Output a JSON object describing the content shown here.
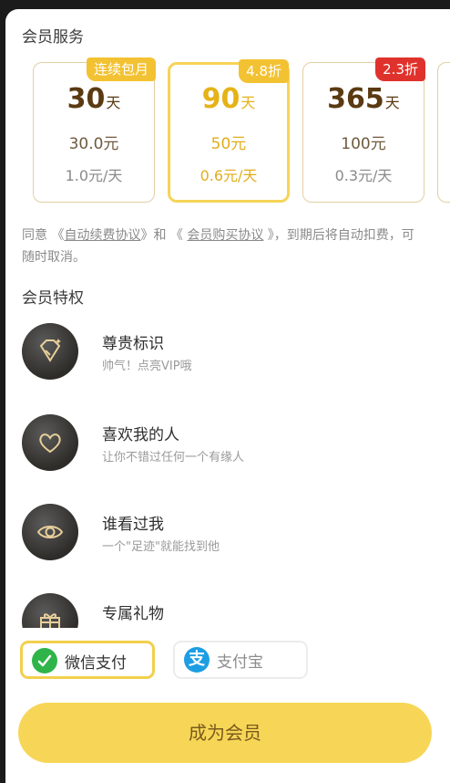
{
  "colors": {
    "accent": "#f7d657",
    "badge_gold": "#f3c232",
    "badge_red": "#e0322c",
    "wechat": "#2fb44a",
    "alipay": "#1d9ee3"
  },
  "sections": {
    "service_title": "会员服务",
    "privilege_title": "会员特权"
  },
  "plans": [
    {
      "badge": "连续包月",
      "days": "30",
      "unit": "天",
      "price": "30.0元",
      "per_day": "1.0元/天"
    },
    {
      "badge": "4.8折",
      "days": "90",
      "unit": "天",
      "price": "50元",
      "per_day": "0.6元/天"
    },
    {
      "badge": "2.3折",
      "days": "365",
      "unit": "天",
      "price": "100元",
      "per_day": "0.3元/天"
    }
  ],
  "agreement": {
    "prefix": "同意 《",
    "link1": "自动续费协议",
    "mid": "》和 《 ",
    "link2": "会员购买协议",
    "suffix": " 》，到期后将自动扣费，可随时取消。"
  },
  "privileges": [
    {
      "icon": "diamond-icon",
      "name": "尊贵标识",
      "desc": "帅气！点亮VIP哦"
    },
    {
      "icon": "heart-icon",
      "name": "喜欢我的人",
      "desc": "让你不错过任何一个有缘人"
    },
    {
      "icon": "eye-icon",
      "name": "谁看过我",
      "desc": "一个\"足迹\"就能找到他"
    },
    {
      "icon": "gift-icon",
      "name": "专属礼物",
      "desc": ""
    }
  ],
  "payment": {
    "wechat_label": "微信支付",
    "alipay_label": "支付宝",
    "alipay_glyph": "支",
    "selected": "wechat"
  },
  "cta": {
    "label": "成为会员"
  }
}
